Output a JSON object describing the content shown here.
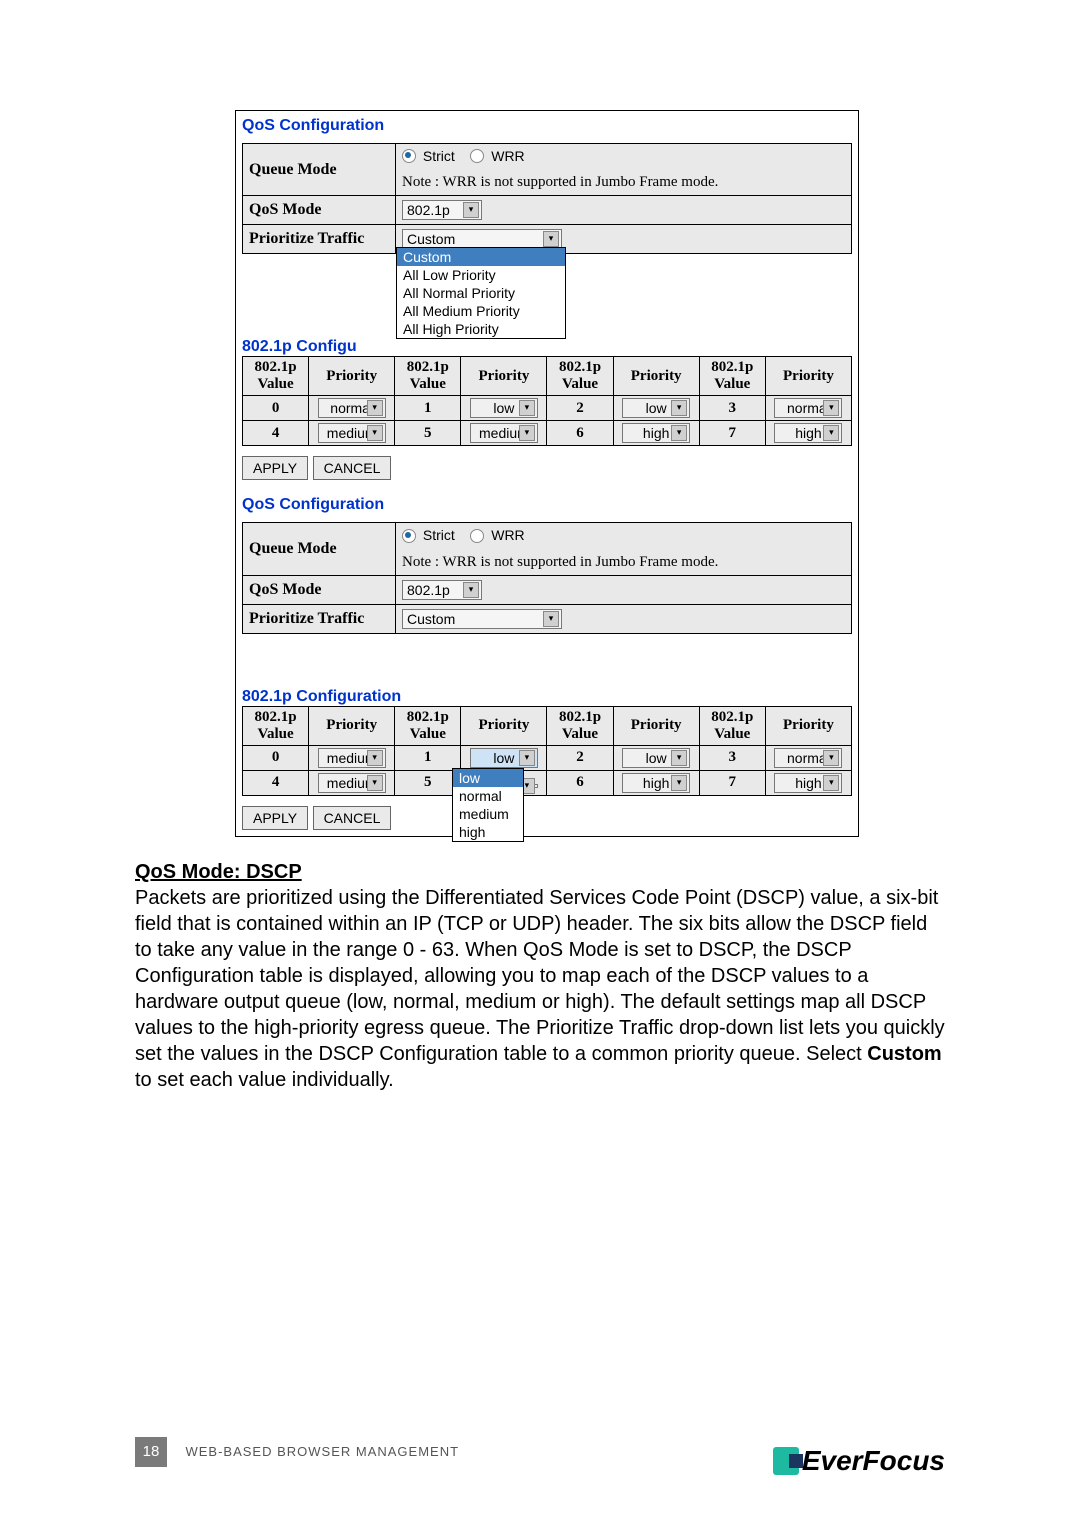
{
  "panel1": {
    "title": "QoS Configuration",
    "queue_mode_label": "Queue Mode",
    "strict": "Strict",
    "wrr": "WRR",
    "note": "Note : WRR is not supported in Jumbo Frame mode.",
    "qos_mode_label": "QoS Mode",
    "qos_mode_value": "802.1p",
    "prio_traffic_label": "Prioritize Traffic",
    "prio_traffic_value": "Custom",
    "prio_options": [
      "Custom",
      "All Low Priority",
      "All Normal Priority",
      "All Medium Priority",
      "All High Priority"
    ],
    "sect": "802.1p Configu",
    "hdr_val": "802.1p Value",
    "hdr_pri": "Priority",
    "rows": [
      {
        "v": "0",
        "p": "normal"
      },
      {
        "v": "1",
        "p": "low"
      },
      {
        "v": "2",
        "p": "low"
      },
      {
        "v": "3",
        "p": "normal"
      },
      {
        "v": "4",
        "p": "medium"
      },
      {
        "v": "5",
        "p": "medium"
      },
      {
        "v": "6",
        "p": "high"
      },
      {
        "v": "7",
        "p": "high"
      }
    ],
    "apply": "APPLY",
    "cancel": "CANCEL"
  },
  "panel2": {
    "title": "QoS Configuration",
    "queue_mode_label": "Queue Mode",
    "strict": "Strict",
    "wrr": "WRR",
    "note": "Note : WRR is not supported in Jumbo Frame mode.",
    "qos_mode_label": "QoS Mode",
    "qos_mode_value": "802.1p",
    "prio_traffic_label": "Prioritize Traffic",
    "prio_traffic_value": "Custom",
    "sect": "802.1p Configuration",
    "hdr_val": "802.1p Value",
    "hdr_pri": "Priority",
    "rows": [
      {
        "v": "0",
        "p": "medium"
      },
      {
        "v": "1",
        "p": "low"
      },
      {
        "v": "2",
        "p": "low"
      },
      {
        "v": "3",
        "p": "normal"
      },
      {
        "v": "4",
        "p": "medium"
      },
      {
        "v": "5",
        "p": ""
      },
      {
        "v": "6",
        "p": "high"
      },
      {
        "v": "7",
        "p": "high"
      }
    ],
    "cell5_options": [
      "low",
      "normal",
      "medium",
      "high"
    ],
    "apply": "APPLY",
    "cancel": "CANCEL"
  },
  "body": {
    "heading": "QoS Mode: DSCP",
    "text1": "Packets are prioritized using the Differentiated Services Code Point (DSCP) value, a six-bit field that is contained within an IP (TCP or UDP) header. The six bits allow the DSCP field to take any value in the range 0 - 63. When QoS Mode is set to DSCP, the DSCP Configuration table is displayed, allowing you to map each of the DSCP values to a hardware output queue (low, normal, medium or high). The default settings map all DSCP values to the high-priority egress queue. The Prioritize Traffic drop-down list lets you quickly set the values in the DSCP Configuration table to a common priority queue. Select ",
    "custom_word": "Custom",
    "text2": " to set each value individually."
  },
  "footer": {
    "page": "18",
    "caption": "WEB-BASED BROWSER MANAGEMENT",
    "brand": "EverFocus"
  }
}
